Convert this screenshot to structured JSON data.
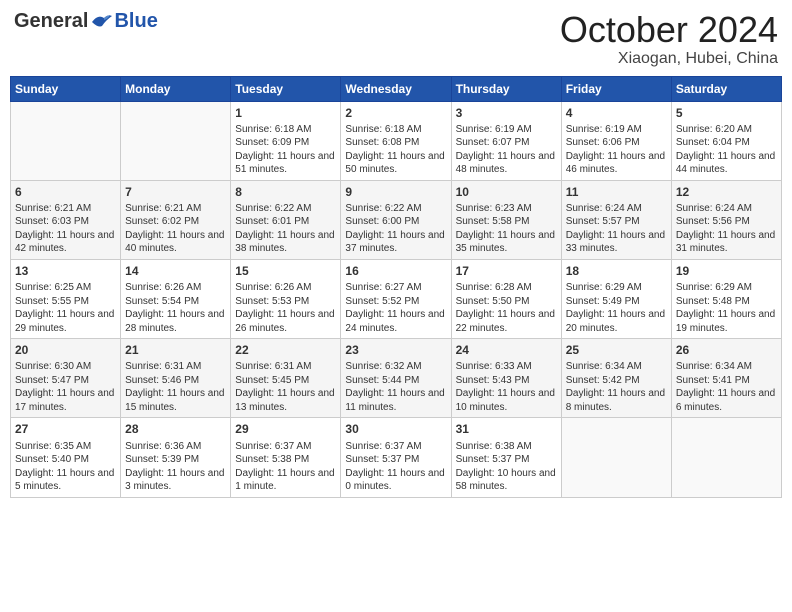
{
  "header": {
    "logo_general": "General",
    "logo_blue": "Blue",
    "month": "October 2024",
    "location": "Xiaogan, Hubei, China"
  },
  "weekdays": [
    "Sunday",
    "Monday",
    "Tuesday",
    "Wednesday",
    "Thursday",
    "Friday",
    "Saturday"
  ],
  "weeks": [
    [
      {
        "day": "",
        "sunrise": "",
        "sunset": "",
        "daylight": "",
        "empty": true
      },
      {
        "day": "",
        "sunrise": "",
        "sunset": "",
        "daylight": "",
        "empty": true
      },
      {
        "day": "1",
        "sunrise": "Sunrise: 6:18 AM",
        "sunset": "Sunset: 6:09 PM",
        "daylight": "Daylight: 11 hours and 51 minutes."
      },
      {
        "day": "2",
        "sunrise": "Sunrise: 6:18 AM",
        "sunset": "Sunset: 6:08 PM",
        "daylight": "Daylight: 11 hours and 50 minutes."
      },
      {
        "day": "3",
        "sunrise": "Sunrise: 6:19 AM",
        "sunset": "Sunset: 6:07 PM",
        "daylight": "Daylight: 11 hours and 48 minutes."
      },
      {
        "day": "4",
        "sunrise": "Sunrise: 6:19 AM",
        "sunset": "Sunset: 6:06 PM",
        "daylight": "Daylight: 11 hours and 46 minutes."
      },
      {
        "day": "5",
        "sunrise": "Sunrise: 6:20 AM",
        "sunset": "Sunset: 6:04 PM",
        "daylight": "Daylight: 11 hours and 44 minutes."
      }
    ],
    [
      {
        "day": "6",
        "sunrise": "Sunrise: 6:21 AM",
        "sunset": "Sunset: 6:03 PM",
        "daylight": "Daylight: 11 hours and 42 minutes."
      },
      {
        "day": "7",
        "sunrise": "Sunrise: 6:21 AM",
        "sunset": "Sunset: 6:02 PM",
        "daylight": "Daylight: 11 hours and 40 minutes."
      },
      {
        "day": "8",
        "sunrise": "Sunrise: 6:22 AM",
        "sunset": "Sunset: 6:01 PM",
        "daylight": "Daylight: 11 hours and 38 minutes."
      },
      {
        "day": "9",
        "sunrise": "Sunrise: 6:22 AM",
        "sunset": "Sunset: 6:00 PM",
        "daylight": "Daylight: 11 hours and 37 minutes."
      },
      {
        "day": "10",
        "sunrise": "Sunrise: 6:23 AM",
        "sunset": "Sunset: 5:58 PM",
        "daylight": "Daylight: 11 hours and 35 minutes."
      },
      {
        "day": "11",
        "sunrise": "Sunrise: 6:24 AM",
        "sunset": "Sunset: 5:57 PM",
        "daylight": "Daylight: 11 hours and 33 minutes."
      },
      {
        "day": "12",
        "sunrise": "Sunrise: 6:24 AM",
        "sunset": "Sunset: 5:56 PM",
        "daylight": "Daylight: 11 hours and 31 minutes."
      }
    ],
    [
      {
        "day": "13",
        "sunrise": "Sunrise: 6:25 AM",
        "sunset": "Sunset: 5:55 PM",
        "daylight": "Daylight: 11 hours and 29 minutes."
      },
      {
        "day": "14",
        "sunrise": "Sunrise: 6:26 AM",
        "sunset": "Sunset: 5:54 PM",
        "daylight": "Daylight: 11 hours and 28 minutes."
      },
      {
        "day": "15",
        "sunrise": "Sunrise: 6:26 AM",
        "sunset": "Sunset: 5:53 PM",
        "daylight": "Daylight: 11 hours and 26 minutes."
      },
      {
        "day": "16",
        "sunrise": "Sunrise: 6:27 AM",
        "sunset": "Sunset: 5:52 PM",
        "daylight": "Daylight: 11 hours and 24 minutes."
      },
      {
        "day": "17",
        "sunrise": "Sunrise: 6:28 AM",
        "sunset": "Sunset: 5:50 PM",
        "daylight": "Daylight: 11 hours and 22 minutes."
      },
      {
        "day": "18",
        "sunrise": "Sunrise: 6:29 AM",
        "sunset": "Sunset: 5:49 PM",
        "daylight": "Daylight: 11 hours and 20 minutes."
      },
      {
        "day": "19",
        "sunrise": "Sunrise: 6:29 AM",
        "sunset": "Sunset: 5:48 PM",
        "daylight": "Daylight: 11 hours and 19 minutes."
      }
    ],
    [
      {
        "day": "20",
        "sunrise": "Sunrise: 6:30 AM",
        "sunset": "Sunset: 5:47 PM",
        "daylight": "Daylight: 11 hours and 17 minutes."
      },
      {
        "day": "21",
        "sunrise": "Sunrise: 6:31 AM",
        "sunset": "Sunset: 5:46 PM",
        "daylight": "Daylight: 11 hours and 15 minutes."
      },
      {
        "day": "22",
        "sunrise": "Sunrise: 6:31 AM",
        "sunset": "Sunset: 5:45 PM",
        "daylight": "Daylight: 11 hours and 13 minutes."
      },
      {
        "day": "23",
        "sunrise": "Sunrise: 6:32 AM",
        "sunset": "Sunset: 5:44 PM",
        "daylight": "Daylight: 11 hours and 11 minutes."
      },
      {
        "day": "24",
        "sunrise": "Sunrise: 6:33 AM",
        "sunset": "Sunset: 5:43 PM",
        "daylight": "Daylight: 11 hours and 10 minutes."
      },
      {
        "day": "25",
        "sunrise": "Sunrise: 6:34 AM",
        "sunset": "Sunset: 5:42 PM",
        "daylight": "Daylight: 11 hours and 8 minutes."
      },
      {
        "day": "26",
        "sunrise": "Sunrise: 6:34 AM",
        "sunset": "Sunset: 5:41 PM",
        "daylight": "Daylight: 11 hours and 6 minutes."
      }
    ],
    [
      {
        "day": "27",
        "sunrise": "Sunrise: 6:35 AM",
        "sunset": "Sunset: 5:40 PM",
        "daylight": "Daylight: 11 hours and 5 minutes."
      },
      {
        "day": "28",
        "sunrise": "Sunrise: 6:36 AM",
        "sunset": "Sunset: 5:39 PM",
        "daylight": "Daylight: 11 hours and 3 minutes."
      },
      {
        "day": "29",
        "sunrise": "Sunrise: 6:37 AM",
        "sunset": "Sunset: 5:38 PM",
        "daylight": "Daylight: 11 hours and 1 minute."
      },
      {
        "day": "30",
        "sunrise": "Sunrise: 6:37 AM",
        "sunset": "Sunset: 5:37 PM",
        "daylight": "Daylight: 11 hours and 0 minutes."
      },
      {
        "day": "31",
        "sunrise": "Sunrise: 6:38 AM",
        "sunset": "Sunset: 5:37 PM",
        "daylight": "Daylight: 10 hours and 58 minutes."
      },
      {
        "day": "",
        "sunrise": "",
        "sunset": "",
        "daylight": "",
        "empty": true
      },
      {
        "day": "",
        "sunrise": "",
        "sunset": "",
        "daylight": "",
        "empty": true
      }
    ]
  ]
}
